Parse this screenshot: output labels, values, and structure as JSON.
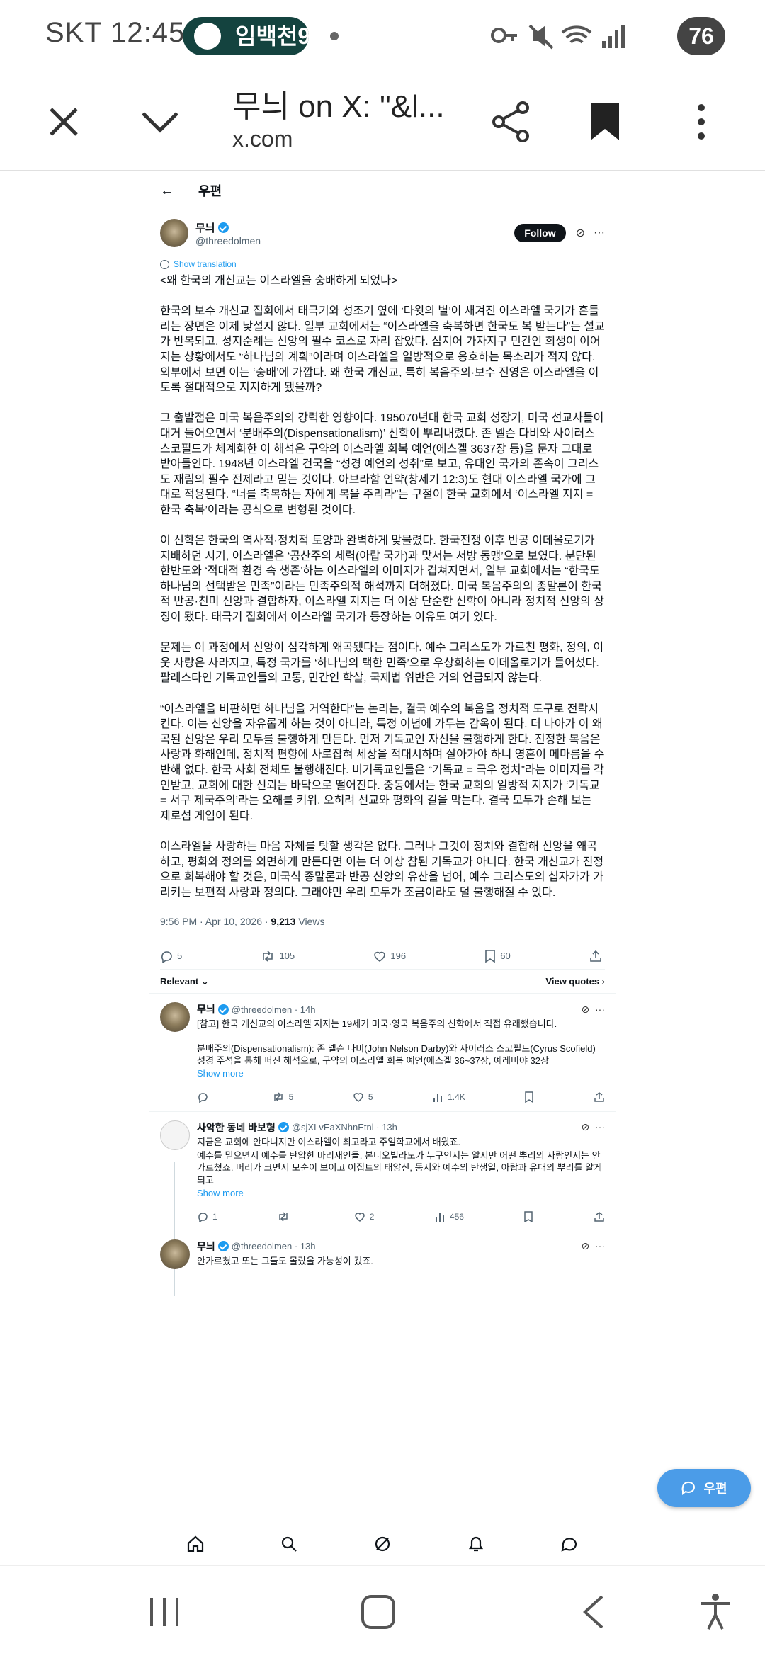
{
  "status_bar": {
    "carrier_time": "SKT 12:45",
    "notification_pill": "임백천9",
    "battery": "76"
  },
  "browser": {
    "page_title": "무늬 on X: \"&l...",
    "url": "x.com"
  },
  "x_header": {
    "title": "우편"
  },
  "post": {
    "author_name": "무늬",
    "author_handle": "@threedolmen",
    "follow_label": "Follow",
    "show_translation": "Show translation",
    "paragraphs": [
      "<왜 한국의 개신교는 이스라엘을 숭배하게 되었나>",
      "한국의 보수 개신교 집회에서 태극기와 성조기 옆에 ‘다윗의 별’이 새겨진 이스라엘 국기가 흔들리는 장면은 이제 낯설지 않다. 일부 교회에서는 “이스라엘을 축복하면 한국도 복 받는다”는 설교가 반복되고, 성지순례는 신앙의 필수 코스로 자리 잡았다. 심지어 가자지구 민간인 희생이 이어지는 상황에서도 “하나님의 계획”이라며 이스라엘을 일방적으로 옹호하는 목소리가 적지 않다. 외부에서 보면 이는 ‘숭배’에 가깝다. 왜 한국 개신교, 특히 복음주의·보수 진영은 이스라엘을 이토록 절대적으로 지지하게 됐을까?",
      "그 출발점은 미국 복음주의의 강력한 영향이다. 195070년대 한국 교회 성장기, 미국 선교사들이 대거 들어오면서 ‘분배주의(Dispensationalism)’ 신학이 뿌리내렸다. 존 넬슨 다비와 사이러스 스코필드가 체계화한 이 해석은 구약의 이스라엘 회복 예언(에스겔 3637장 등)을 문자 그대로 받아들인다. 1948년 이스라엘 건국을 “성경 예언의 성취”로 보고, 유대인 국가의 존속이 그리스도 재림의 필수 전제라고 믿는 것이다. 아브라함 언약(창세기 12:3)도 현대 이스라엘 국가에 그대로 적용된다. “너를 축복하는 자에게 복을 주리라”는 구절이 한국 교회에서 ‘이스라엘 지지 = 한국 축복’이라는 공식으로 변형된 것이다.",
      "이 신학은 한국의 역사적·정치적 토양과 완벽하게 맞물렸다. 한국전쟁 이후 반공 이데올로기가 지배하던 시기, 이스라엘은 ‘공산주의 세력(아랍 국가)과 맞서는 서방 동맹’으로 보였다. 분단된 한반도와 ‘적대적 환경 속 생존’하는 이스라엘의 이미지가 겹쳐지면서, 일부 교회에서는 “한국도 하나님의 선택받은 민족”이라는 민족주의적 해석까지 더해졌다. 미국 복음주의의 종말론이 한국적 반공·친미 신앙과 결합하자, 이스라엘 지지는 더 이상 단순한 신학이 아니라 정치적 신앙의 상징이 됐다. 태극기 집회에서 이스라엘 국기가 등장하는 이유도 여기 있다.",
      "문제는 이 과정에서 신앙이 심각하게 왜곡됐다는 점이다. 예수 그리스도가 가르친 평화, 정의, 이웃 사랑은 사라지고, 특정 국가를 ‘하나님의 택한 민족’으로 우상화하는 이데올로기가 들어섰다. 팔레스타인 기독교인들의 고통, 민간인 학살, 국제법 위반은 거의 언급되지 않는다.",
      "“이스라엘을 비판하면 하나님을 거역한다”는 논리는, 결국 예수의 복음을 정치적 도구로 전락시킨다. 이는 신앙을 자유롭게 하는 것이 아니라, 특정 이념에 가두는 감옥이 된다. 더 나아가 이 왜곡된 신앙은 우리 모두를 불행하게 만든다. 먼저 기독교인 자신을 불행하게 한다. 진정한 복음은 사랑과 화해인데, 정치적 편향에 사로잡혀 세상을 적대시하며 살아가야 하니 영혼이 메마름을 수반해 없다. 한국 사회 전체도 불행해진다. 비기독교인들은 “기독교 = 극우 정치”라는 이미지를 각인받고, 교회에 대한 신뢰는 바닥으로 떨어진다. 중동에서는 한국 교회의 일방적 지지가 ‘기독교 = 서구 제국주의’라는 오해를 키워, 오히려 선교와 평화의 길을 막는다. 결국 모두가 손해 보는 제로섬 게임이 된다.",
      "이스라엘을 사랑하는 마음 자체를 탓할 생각은 없다. 그러나 그것이 정치와 결합해 신앙을 왜곡하고, 평화와 정의를 외면하게 만든다면 이는 더 이상 참된 기독교가 아니다. 한국 개신교가 진정으로 회복해야 할 것은, 미국식 종말론과 반공 신앙의 유산을 넘어, 예수 그리스도의 십자가가 가리키는 보편적 사랑과 정의다. 그래야만 우리 모두가 조금이라도 덜 불행해질 수 있다."
    ],
    "timestamp": "9:56 PM · Apr 10, 2026 · ",
    "views_count": "9,213",
    "views_label": " Views",
    "stats": {
      "replies": "5",
      "reposts": "105",
      "likes": "196",
      "bookmarks": "60"
    }
  },
  "sort_bar": {
    "relevant": "Relevant",
    "view_quotes": "View quotes"
  },
  "replies": [
    {
      "name": "무늬",
      "handle": "@threedolmen · 14h",
      "text1": "[참고] 한국 개신교의 이스라엘 지지는 19세기 미국·영국 복음주의 신학에서 직접 유래했습니다.",
      "text2": "분배주의(Dispensationalism): 존 넬슨 다비(John Nelson Darby)와 사이러스 스코필드(Cyrus Scofield) 성경 주석을 통해 퍼진 해석으로, 구약의 이스라엘 회복 예언(에스겔 36~37장, 예레미야 32장",
      "show_more": "Show more",
      "stats": {
        "replies": "",
        "reposts": "5",
        "likes": "5",
        "views": "1.4K"
      }
    },
    {
      "name": "사악한 동네 바보형",
      "handle": "@sjXLvEaXNhnEtnl · 13h",
      "text1": "지금은 교회에 안다니지만 이스라엘이 최고라고 주일학교에서 배웠죠.",
      "text2": "예수를 믿으면서 예수를 탄압한 바리새인들, 본디오빌라도가 누구인지는 알지만 어떤 뿌리의 사람인지는 안가르쳤죠. 머리가 크면서 모순이 보이고 이집트의 태양신, 동지와 예수의 탄생일, 아랍과 유대의 뿌리를 알게 되고",
      "show_more": "Show more",
      "stats": {
        "replies": "1",
        "reposts": "",
        "likes": "2",
        "views": "456"
      }
    },
    {
      "name": "무늬",
      "handle": "@threedolmen · 13h",
      "text1": "안가르쳤고 또는 그들도 몰랐을 가능성이 컸죠."
    }
  ],
  "fab_label": "우편"
}
